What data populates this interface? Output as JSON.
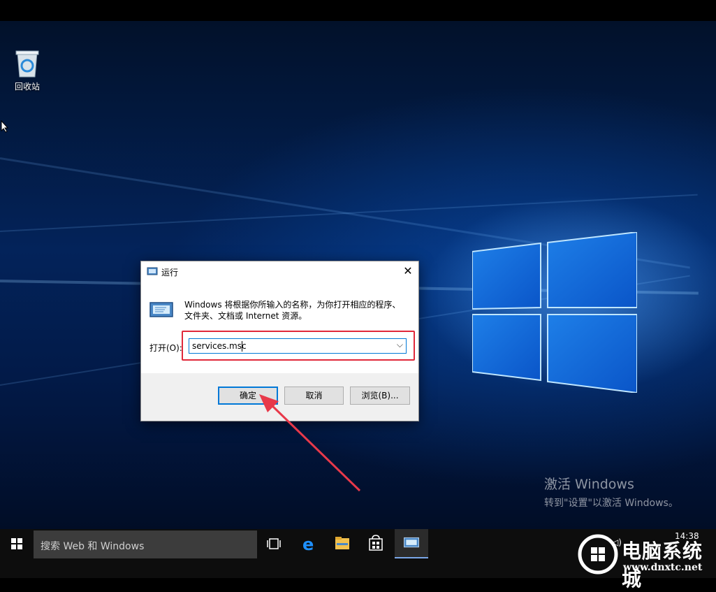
{
  "desktop": {
    "recycle_bin_label": "回收站",
    "watermark_title": "激活 Windows",
    "watermark_sub": "转到\"设置\"以激活 Windows。"
  },
  "run_dialog": {
    "title": "运行",
    "close_glyph": "✕",
    "description": "Windows 将根据你所输入的名称，为你打开相应的程序、文件夹、文档或 Internet 资源。",
    "open_label": "打开(O):",
    "open_value": "services.msc",
    "dropdown_glyph": "⌵",
    "ok_label": "确定",
    "cancel_label": "取消",
    "browse_label": "浏览(B)..."
  },
  "taskbar": {
    "search_placeholder": "搜索 Web 和 Windows",
    "clock_time": "14:38",
    "tray_glyph": "◁)"
  },
  "site_watermark": {
    "name": "电脑系统城",
    "url": "www.dnxtc.net"
  },
  "colors": {
    "accent": "#0078d7",
    "highlight_box": "#e0283a",
    "arrow": "#e8394a"
  }
}
